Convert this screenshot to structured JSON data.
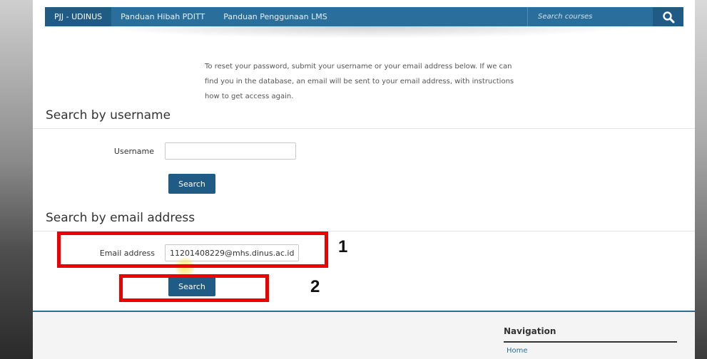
{
  "navbar": {
    "items": [
      {
        "label": "PJJ - UDINUS"
      },
      {
        "label": "Panduan Hibah PDITT"
      },
      {
        "label": "Panduan Penggunaan LMS"
      }
    ],
    "search_placeholder": "Search courses",
    "search_icon": "search-icon"
  },
  "intro": {
    "text": "To reset your password, submit your username or your email address below. If we can find you in the database, an email will be sent to your email address, with instructions how to get access again."
  },
  "username_section": {
    "title": "Search by username",
    "label": "Username",
    "value": "",
    "button": "Search"
  },
  "email_section": {
    "title": "Search by email address",
    "label": "Email address",
    "value": "11201408229@mhs.dinus.ac.id",
    "button": "Search"
  },
  "annotations": {
    "step1": "1",
    "step2": "2",
    "highlight_color": "#ee0000"
  },
  "footer": {
    "nav_title": "Navigation",
    "home_link": "Home"
  },
  "colors": {
    "brand": "#2a6f9c",
    "brand_dark": "#1f5b84"
  }
}
